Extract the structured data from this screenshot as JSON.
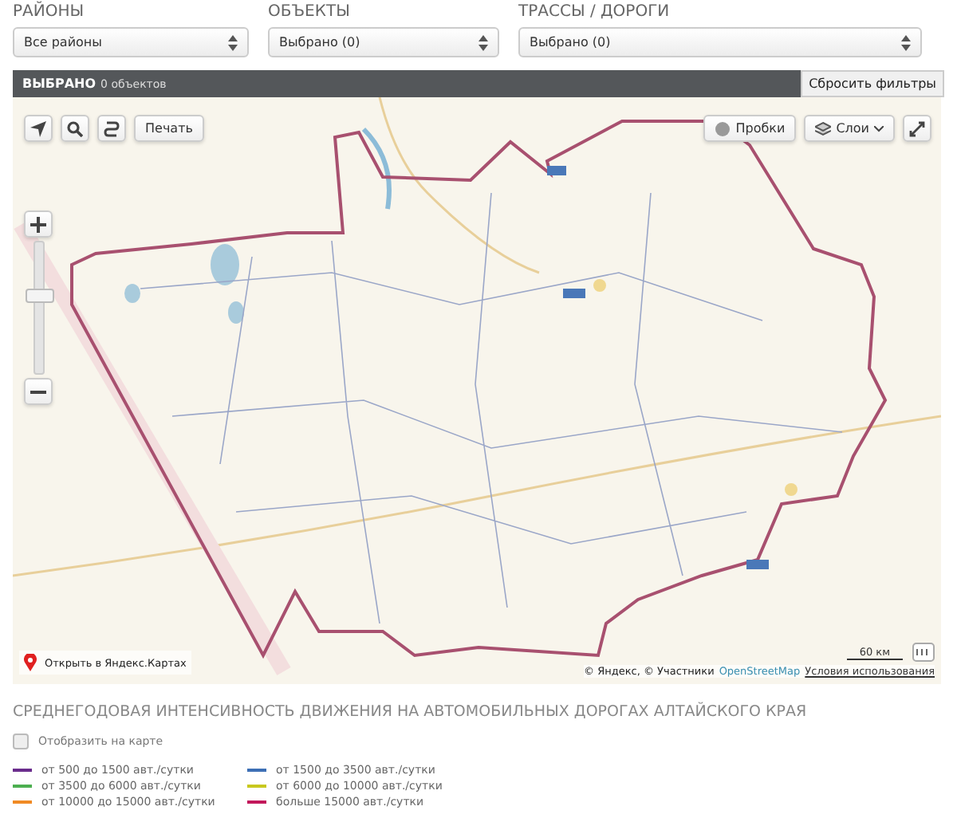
{
  "filters": [
    {
      "label": "РАЙОНЫ",
      "value": "Все районы"
    },
    {
      "label": "ОБЪЕКТЫ",
      "value": "Выбрано (0)"
    },
    {
      "label": "ТРАССЫ / ДОРОГИ",
      "value": "Выбрано (0)"
    }
  ],
  "selection_bar": {
    "title": "ВЫБРАНО",
    "count": "0 объектов",
    "reset_button": "Сбросить фильтры"
  },
  "map": {
    "print_button": "Печать",
    "traffic_button": "Пробки",
    "layers_button": "Слои",
    "zoom": {
      "level": 0.6
    },
    "open_link": "Открыть в Яндекс.Картах",
    "attribution": "© Яндекс, © Участники",
    "osm_link": "OpenStreetMap",
    "terms_link": "Условия использования",
    "scale": "60 км"
  },
  "legend": {
    "title": "СРЕДНЕГОДОВАЯ ИНТЕНСИВНОСТЬ ДВИЖЕНИЯ НА АВТОМОБИЛЬНЫХ ДОРОГАХ АЛТАЙСКОГО КРАЯ",
    "show_on_map": {
      "label": "Отобразить на карте",
      "checked": false
    },
    "items": [
      {
        "label": "от 500 до 1500 авт./сутки",
        "color": "#6a2c8c"
      },
      {
        "label": "от 1500 до 3500 авт./сутки",
        "color": "#3d6fb5"
      },
      {
        "label": "от 3500 до 6000 авт./сутки",
        "color": "#4caf50"
      },
      {
        "label": "от 6000 до 10000 авт./сутки",
        "color": "#c8c81e"
      },
      {
        "label": "от 10000 до 15000 авт./сутки",
        "color": "#f08a24"
      },
      {
        "label": "больше 15000 авт./сутки",
        "color": "#c2185b"
      }
    ]
  }
}
